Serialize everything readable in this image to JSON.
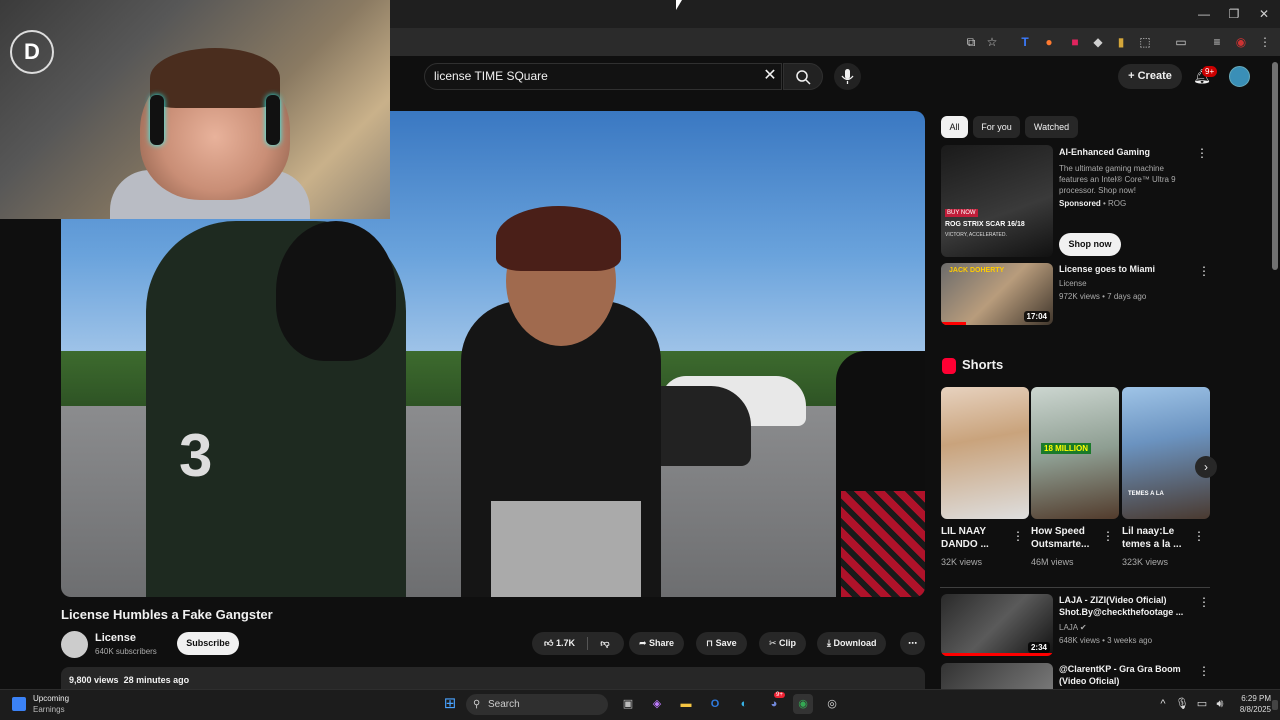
{
  "search": {
    "query": "license TIME SQuare"
  },
  "header": {
    "create_label": "Create",
    "notif_badge": "9+"
  },
  "webcam": {
    "logo_letter": "D"
  },
  "player": {
    "jersey_number": "3"
  },
  "video": {
    "title": "License Humbles a Fake Gangster",
    "channel": "License",
    "subscribers": "640K subscribers",
    "subscribe_label": "Subscribe",
    "likes": "1.7K",
    "share_label": "Share",
    "save_label": "Save",
    "clip_label": "Clip",
    "download_label": "Download",
    "views": "9,800 views",
    "age": "28 minutes ago"
  },
  "chips": [
    "All",
    "For you",
    "Watched"
  ],
  "ad": {
    "title": "AI-Enhanced Gaming",
    "description": "The ultimate gaming machine features an Intel® Core™ Ultra 9 processor. Shop now!",
    "sponsored": "Sponsored",
    "advertiser": "ROG",
    "cta": "Shop now",
    "thumb_text1": "ROG STRIX SCAR 16/18",
    "thumb_text2": "VICTORY, ACCELERATED.",
    "thumb_badge": "BUY NOW"
  },
  "rec1": {
    "title": "License goes to Miami",
    "channel": "License",
    "meta": "972K views • 7 days ago",
    "duration": "17:04",
    "thumb_text": "JACK DOHERTY"
  },
  "shorts": {
    "heading": "Shorts",
    "items": [
      {
        "title": "LIL NAAY DANDO ...",
        "views": "32K views"
      },
      {
        "title": "How Speed Outsmarte...",
        "views": "46M views",
        "thumb_text": "18 MILLION"
      },
      {
        "title": "Lil naay:Le temes a la ...",
        "views": "323K views",
        "thumb_text": "TEMES A LA"
      }
    ]
  },
  "rec2": {
    "title": "LAJA - ZIZI(Video Oficial) Shot.By@checkthefootage ...",
    "channel": "LAJA",
    "meta": "648K views • 3 weeks ago",
    "duration": "2:34"
  },
  "rec3": {
    "title": "@ClarentKP - Gra Gra Boom (Video Oficial)"
  },
  "taskbar": {
    "weather_title": "Upcoming",
    "weather_sub": "Earnings",
    "search_label": "Search",
    "time": "6:29 PM",
    "date": "8/8/2025",
    "discord_badge": "9+"
  }
}
